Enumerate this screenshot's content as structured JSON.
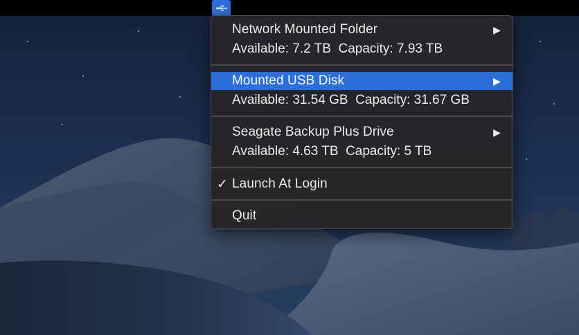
{
  "menubar": {
    "status_icon": "usb-icon"
  },
  "menu": {
    "items": [
      {
        "label": "Network Mounted Folder",
        "detail": "Available: 7.2 TB  Capacity: 7.93 TB",
        "has_submenu": true
      },
      {
        "label": "Mounted USB Disk",
        "detail": "Available: 31.54 GB  Capacity: 31.67 GB",
        "has_submenu": true,
        "highlighted": true
      },
      {
        "label": "Seagate Backup Plus Drive",
        "detail": "Available: 4.63 TB  Capacity: 5 TB",
        "has_submenu": true
      }
    ],
    "launch_at_login": {
      "label": "Launch At Login",
      "checked": true,
      "check_mark": "✓"
    },
    "quit": {
      "label": "Quit"
    },
    "submenu_arrow": "▶"
  },
  "colors": {
    "highlight": "#2a6fdb",
    "menu_background": "#262628",
    "menubar": "#000000"
  }
}
